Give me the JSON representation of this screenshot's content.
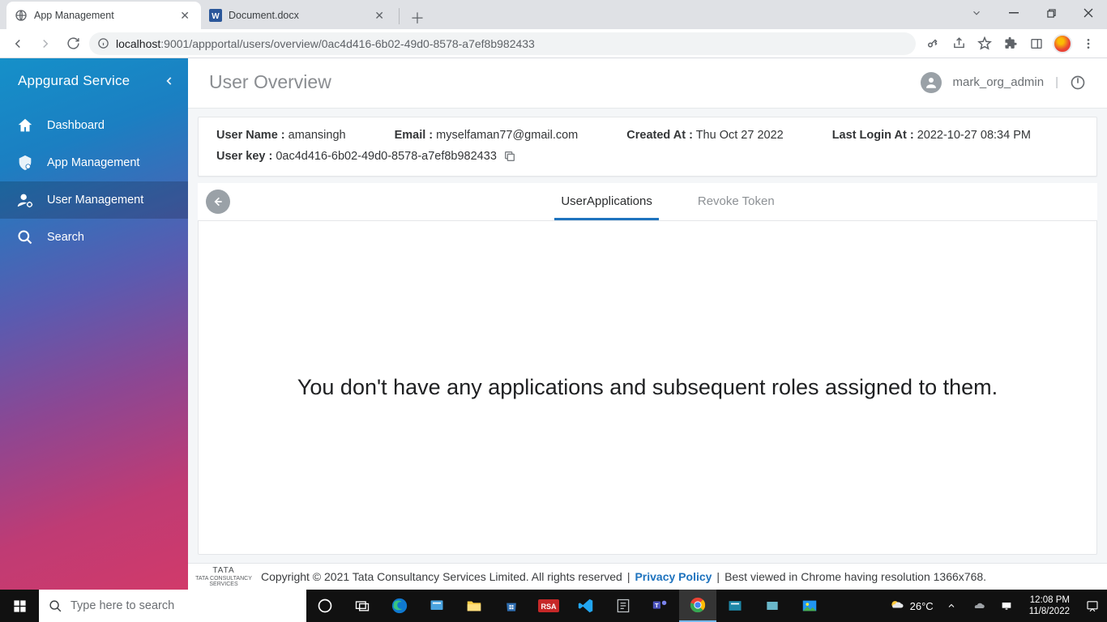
{
  "browser": {
    "tabs": [
      {
        "title": "App Management",
        "active": true
      },
      {
        "title": "Document.docx",
        "active": false
      }
    ],
    "url_host": "localhost",
    "url_port": ":9001",
    "url_path": "/appportal/users/overview/0ac4d416-6b02-49d0-8578-a7ef8b982433"
  },
  "sidebar": {
    "title": "Appgurad Service",
    "items": [
      {
        "label": "Dashboard"
      },
      {
        "label": "App Management"
      },
      {
        "label": "User Management"
      },
      {
        "label": "Search"
      }
    ]
  },
  "header": {
    "page_title": "User Overview",
    "username": "mark_org_admin"
  },
  "user_info": {
    "name_label": "User Name :",
    "name_value": "amansingh",
    "email_label": "Email :",
    "email_value": "myselfaman77@gmail.com",
    "created_label": "Created At :",
    "created_value": "Thu Oct 27 2022",
    "lastlogin_label": "Last Login At :",
    "lastlogin_value": "2022-10-27 08:34 PM",
    "key_label": "User key :",
    "key_value": "0ac4d416-6b02-49d0-8578-a7ef8b982433"
  },
  "tabs": {
    "items": [
      {
        "label": "UserApplications",
        "active": true
      },
      {
        "label": "Revoke Token",
        "active": false
      }
    ]
  },
  "content": {
    "empty_message": "You don't have any applications and subsequent roles assigned to them."
  },
  "footer": {
    "copyright": "Copyright © 2021 Tata Consultancy Services Limited. All rights reserved",
    "privacy": "Privacy Policy",
    "bestview": "Best viewed in Chrome having resolution 1366x768.",
    "logo_top": "TATA",
    "logo_bottom": "TATA CONSULTANCY SERVICES"
  },
  "taskbar": {
    "search_placeholder": "Type here to search",
    "weather": "26°C",
    "time": "12:08 PM",
    "date": "11/8/2022"
  }
}
